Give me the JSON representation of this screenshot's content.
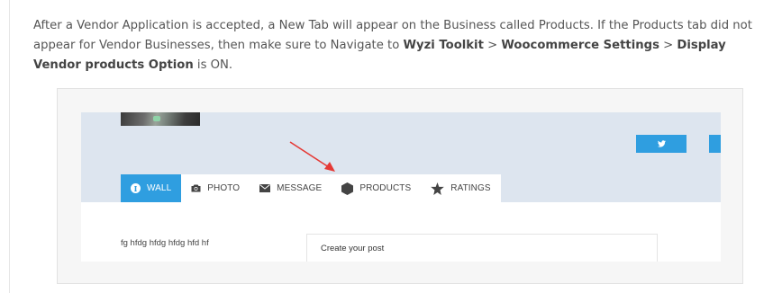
{
  "intro": {
    "text_1": "After a Vendor Application is accepted, a New Tab will appear on the Business called Products. If the Products tab did not appear for Vendor Businesses, then make sure to Navigate to ",
    "path_1": "Wyzi Toolkit",
    "sep_1": " > ",
    "path_2": "Woocommerce Settings",
    "sep_2": " > ",
    "path_3": "Display Vendor products Option",
    "text_2": " is ON."
  },
  "screenshot": {
    "tabs": [
      {
        "label": "WALL",
        "icon": "info-circle-icon",
        "active": true
      },
      {
        "label": "PHOTO",
        "icon": "camera-icon",
        "active": false
      },
      {
        "label": "MESSAGE",
        "icon": "envelope-icon",
        "active": false
      },
      {
        "label": "PRODUCTS",
        "icon": "hexagon-icon",
        "active": false
      },
      {
        "label": "RATINGS",
        "icon": "star-icon",
        "active": false
      }
    ],
    "user_text": "fg hfdg hfdg hfdg hfd hf",
    "post_placeholder": "Create your post",
    "social_icon": "twitter-icon"
  },
  "colors": {
    "accent": "#2f9ee0",
    "cover": "#dde5ef",
    "arrow": "#e53935"
  }
}
